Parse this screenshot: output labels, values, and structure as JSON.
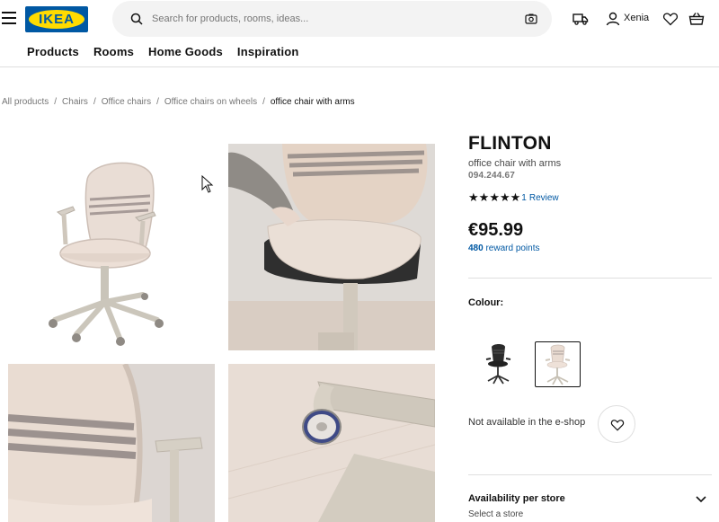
{
  "header": {
    "logo_text": "IKEA",
    "search_placeholder": "Search for products, rooms, ideas...",
    "user_name": "Xenia"
  },
  "nav": {
    "items": [
      "Products",
      "Rooms",
      "Home Goods",
      "Inspiration"
    ]
  },
  "breadcrumb": {
    "items": [
      "All products",
      "Chairs",
      "Office chairs",
      "Office chairs on wheels"
    ],
    "current": "office chair with arms"
  },
  "product": {
    "name": "FLINTON",
    "description": "office chair with arms",
    "article_number": "094.244.67",
    "rating": 5,
    "review_count": "1",
    "review_label": "Review",
    "price": "€95.99",
    "reward_points": "480",
    "reward_label": "reward points"
  },
  "colour": {
    "label": "Colour:",
    "options": [
      "black",
      "beige"
    ],
    "selected": "beige"
  },
  "availability": {
    "eshop_text": "Not available in the e-shop",
    "store_title": "Availability per store",
    "store_subtitle": "Select a store"
  },
  "colors": {
    "brand_blue": "#0058a3",
    "brand_yellow": "#ffdb00",
    "link": "#0058a3"
  },
  "icons": [
    "menu-icon",
    "search-icon",
    "camera-icon",
    "truck-icon",
    "user-icon",
    "heart-icon",
    "basket-icon",
    "star-icon",
    "chevron-down-icon"
  ]
}
